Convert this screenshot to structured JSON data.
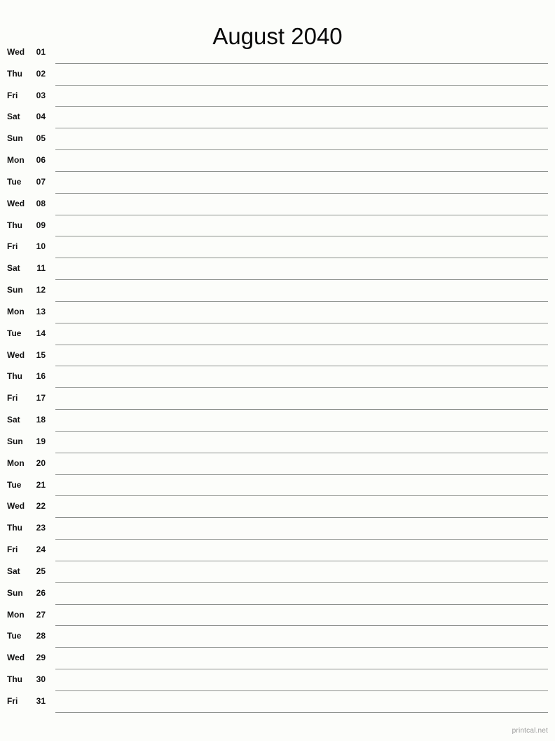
{
  "document": {
    "title": "August 2040",
    "month": "August",
    "year": "2040",
    "background_color": "#fcfdfa",
    "rule_color": "#8d918d",
    "text_color": "#111111"
  },
  "footer": {
    "credit": "printcal.net",
    "color": "#9a9a9a"
  },
  "days": [
    {
      "weekday": "Wed",
      "number": "01"
    },
    {
      "weekday": "Thu",
      "number": "02"
    },
    {
      "weekday": "Fri",
      "number": "03"
    },
    {
      "weekday": "Sat",
      "number": "04"
    },
    {
      "weekday": "Sun",
      "number": "05"
    },
    {
      "weekday": "Mon",
      "number": "06"
    },
    {
      "weekday": "Tue",
      "number": "07"
    },
    {
      "weekday": "Wed",
      "number": "08"
    },
    {
      "weekday": "Thu",
      "number": "09"
    },
    {
      "weekday": "Fri",
      "number": "10"
    },
    {
      "weekday": "Sat",
      "number": "11"
    },
    {
      "weekday": "Sun",
      "number": "12"
    },
    {
      "weekday": "Mon",
      "number": "13"
    },
    {
      "weekday": "Tue",
      "number": "14"
    },
    {
      "weekday": "Wed",
      "number": "15"
    },
    {
      "weekday": "Thu",
      "number": "16"
    },
    {
      "weekday": "Fri",
      "number": "17"
    },
    {
      "weekday": "Sat",
      "number": "18"
    },
    {
      "weekday": "Sun",
      "number": "19"
    },
    {
      "weekday": "Mon",
      "number": "20"
    },
    {
      "weekday": "Tue",
      "number": "21"
    },
    {
      "weekday": "Wed",
      "number": "22"
    },
    {
      "weekday": "Thu",
      "number": "23"
    },
    {
      "weekday": "Fri",
      "number": "24"
    },
    {
      "weekday": "Sat",
      "number": "25"
    },
    {
      "weekday": "Sun",
      "number": "26"
    },
    {
      "weekday": "Mon",
      "number": "27"
    },
    {
      "weekday": "Tue",
      "number": "28"
    },
    {
      "weekday": "Wed",
      "number": "29"
    },
    {
      "weekday": "Thu",
      "number": "30"
    },
    {
      "weekday": "Fri",
      "number": "31"
    }
  ]
}
